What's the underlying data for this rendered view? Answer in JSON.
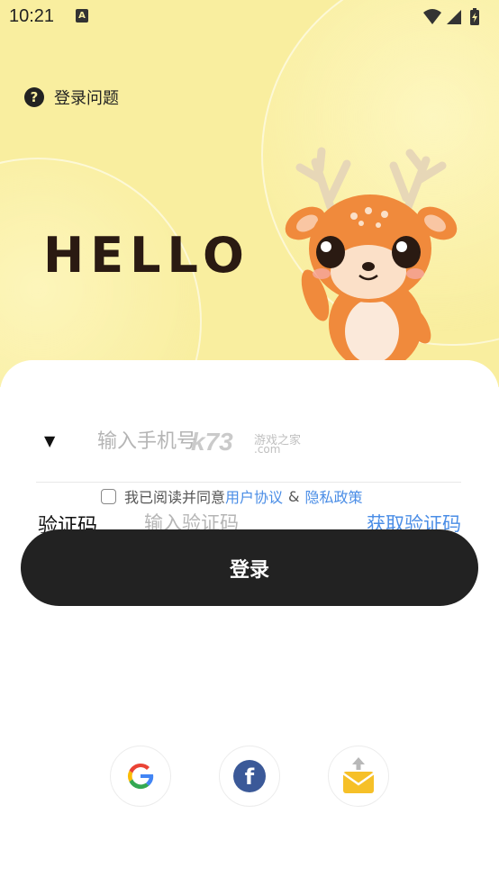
{
  "status_bar": {
    "time": "10:21",
    "notification_icon": "A"
  },
  "header": {
    "help_icon": "?",
    "help_text": "登录问题",
    "hello": "HELLO"
  },
  "form": {
    "country_arrow": "▼",
    "phone_placeholder": "输入手机号",
    "agreement_prefix": "我已阅读并同意",
    "user_agreement": "用户协议",
    "ampersand": "&",
    "privacy_policy": "隐私政策",
    "code_label": "验证码",
    "code_placeholder": "输入验证码",
    "get_code": "获取验证码",
    "login_button": "登录"
  },
  "watermark": {
    "text": "k73",
    "sub": "游戏之家",
    "com": ".com"
  },
  "social": [
    {
      "name": "google",
      "icon": "google-icon"
    },
    {
      "name": "facebook",
      "icon": "facebook-icon",
      "glyph": "f"
    },
    {
      "name": "email",
      "icon": "email-icon"
    }
  ],
  "colors": {
    "hero_bg": "#f9ee9f",
    "button_bg": "#222222",
    "link": "#4a8de6",
    "mascot_orange": "#f08a3c"
  }
}
